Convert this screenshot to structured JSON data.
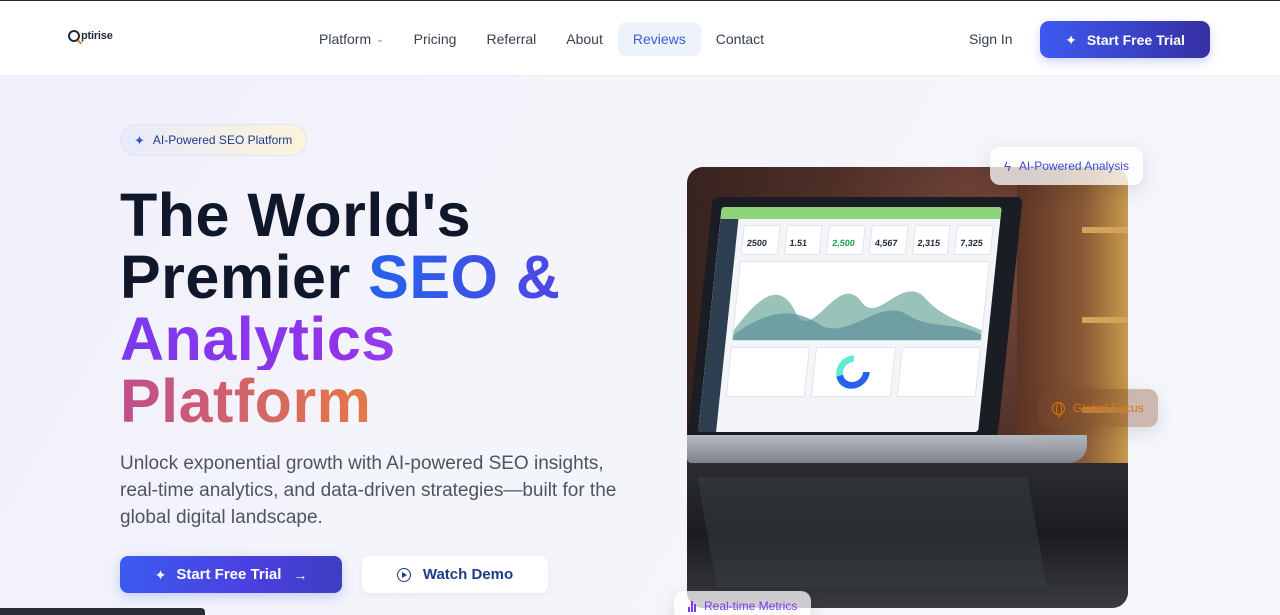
{
  "nav": {
    "logo_text": "ptirise",
    "menu": [
      {
        "label": "Platform",
        "has_dropdown": true
      },
      {
        "label": "Pricing"
      },
      {
        "label": "Referral"
      },
      {
        "label": "About"
      },
      {
        "label": "Reviews",
        "active": true
      },
      {
        "label": "Contact"
      }
    ],
    "sign_in": "Sign In",
    "cta": "Start Free Trial"
  },
  "hero": {
    "badge": "AI-Powered SEO Platform",
    "headline": {
      "line1": "The World's",
      "line2_a": "Premier ",
      "line2_b": "SEO &",
      "line3": "Analytics",
      "line4": "Platform"
    },
    "subtext": "Unlock exponential growth with AI-powered SEO insights, real-time analytics, and data-driven strategies—built for the global digital landscape.",
    "primary_button": "Start Free Trial",
    "secondary_button": "Watch Demo"
  },
  "floating_tags": {
    "ai": "AI-Powered Analysis",
    "global": "Global Focus",
    "metrics": "Real-time Metrics"
  },
  "laptop_screen": {
    "stats": [
      "2500",
      "1.51",
      "2,500",
      "4,567",
      "2,315",
      "7,325"
    ]
  },
  "colors": {
    "primary": "#3d5af1",
    "accent_purple": "#7c3aed",
    "accent_orange": "#f59e0b"
  }
}
